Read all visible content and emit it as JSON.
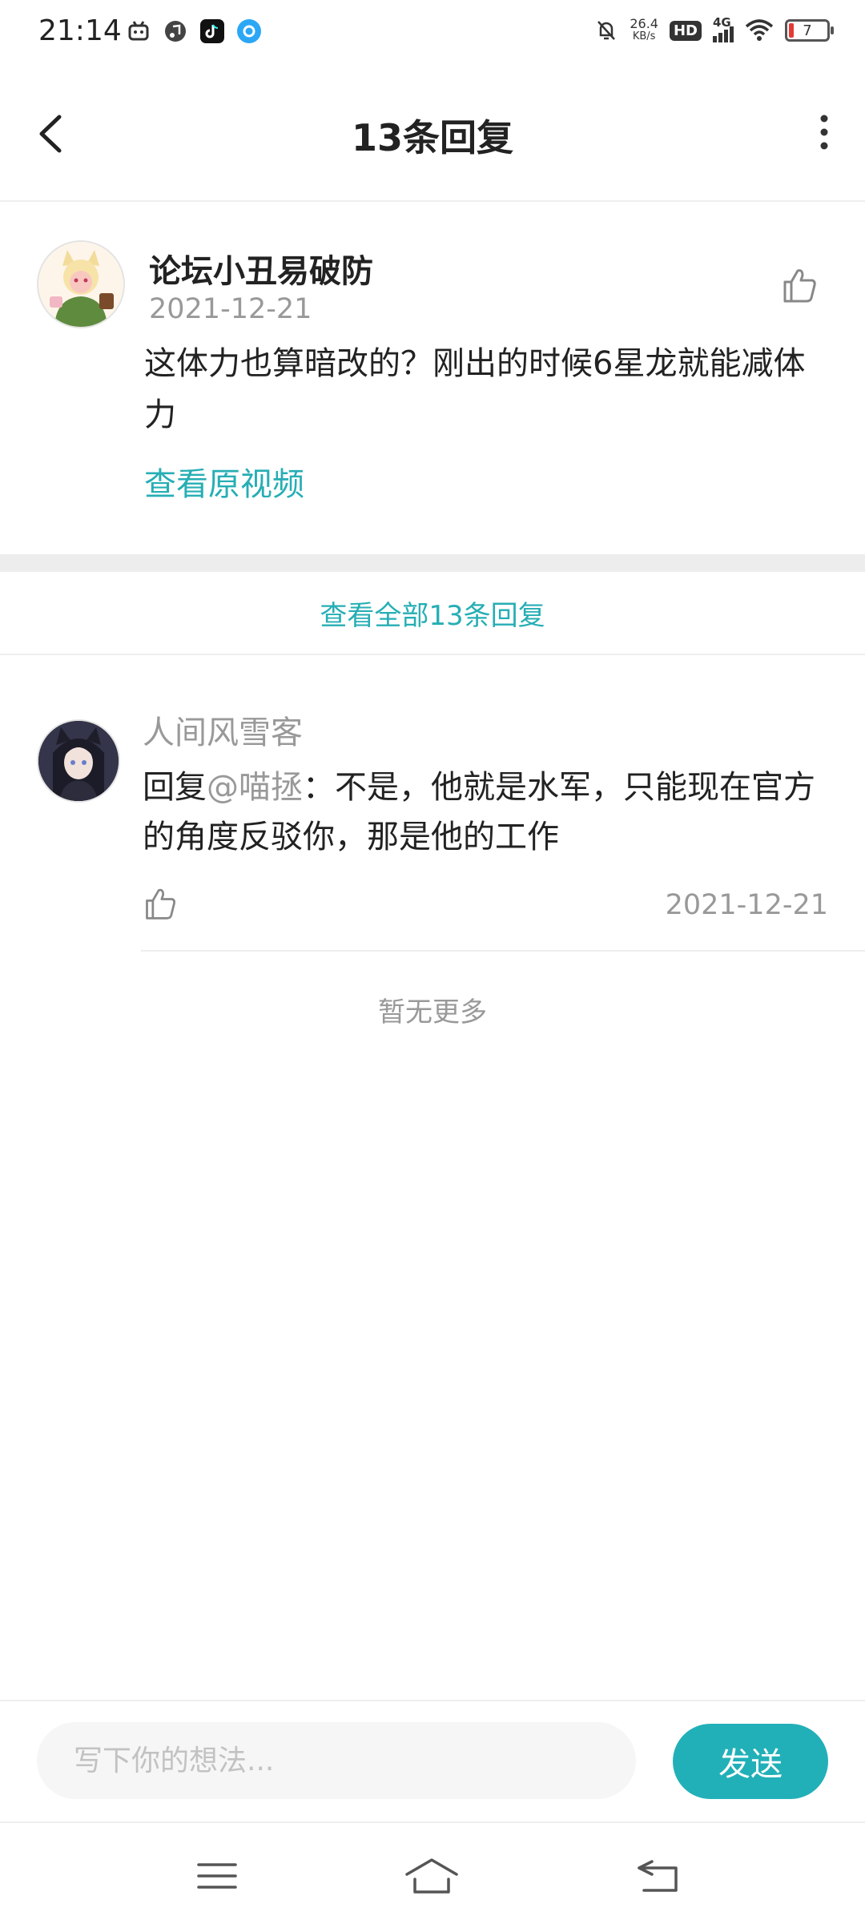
{
  "status_bar": {
    "time": "21:14",
    "net_speed_value": "26.4",
    "net_speed_unit": "KB/s",
    "hd_label": "HD",
    "network_label": "4G",
    "battery_level": "7",
    "app_icons": [
      "bilibili-icon",
      "music-icon",
      "tiktok-icon",
      "browser-icon"
    ]
  },
  "header": {
    "title": "13条回复"
  },
  "main_comment": {
    "author": "论坛小丑易破防",
    "date": "2021-12-21",
    "text": "这体力也算暗改的？刚出的时候6星龙就能减体力",
    "view_original_label": "查看原视频"
  },
  "view_all_label": "查看全部13条回复",
  "replies": [
    {
      "author": "人间风雪客",
      "reply_prefix": "回复",
      "mention": "@喵拯",
      "text": "：不是，他就是水军，只能现在官方的角度反驳你，那是他的工作",
      "date": "2021-12-21"
    }
  ],
  "no_more_label": "暂无更多",
  "input": {
    "placeholder": "写下你的想法...",
    "value": ""
  },
  "send_label": "发送",
  "colors": {
    "accent": "#22b0b8",
    "link": "#26aeb4",
    "secondary_text": "#999999"
  }
}
